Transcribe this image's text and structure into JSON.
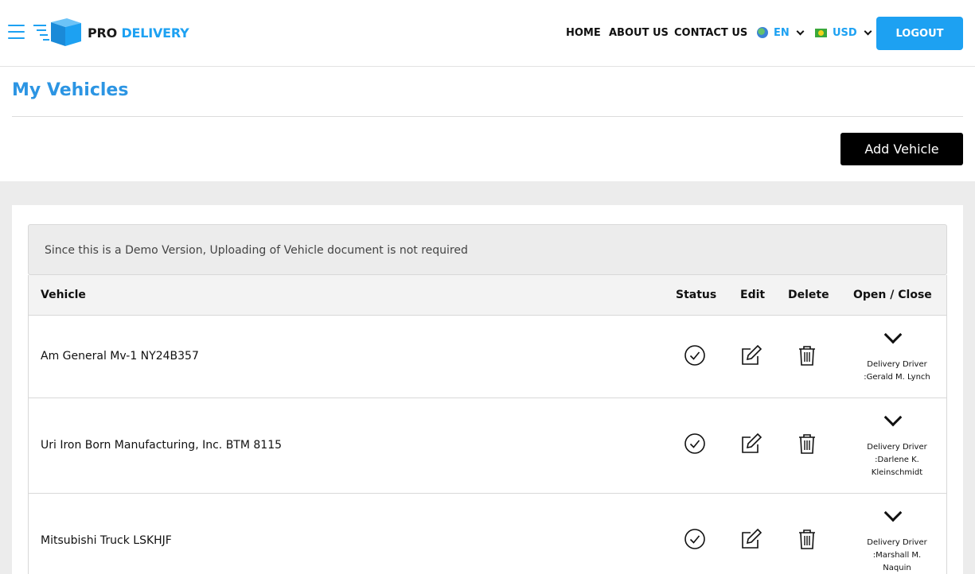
{
  "brand": {
    "pro": "PRO",
    "delivery": "DELIVERY",
    "accent": "#1da1f2"
  },
  "nav": {
    "home": "HOME",
    "about": "ABOUT US",
    "contact": "CONTACT US",
    "language": "EN",
    "currency": "USD",
    "logout": "LOGOUT"
  },
  "page": {
    "title": "My Vehicles",
    "add_button": "Add Vehicle",
    "notice": "Since this is a Demo Version, Uploading of Vehicle document is not required"
  },
  "table": {
    "headers": {
      "vehicle": "Vehicle",
      "status": "Status",
      "edit": "Edit",
      "delete": "Delete",
      "open_close": "Open / Close"
    },
    "rows": [
      {
        "vehicle": "Am General Mv-1 NY24B357",
        "driver_line1": "Delivery Driver",
        "driver_line2": ":Gerald M. Lynch",
        "driver_line3": ""
      },
      {
        "vehicle": "Uri Iron Born Manufacturing, Inc. BTM 8115",
        "driver_line1": "Delivery Driver",
        "driver_line2": ":Darlene K.",
        "driver_line3": "Kleinschmidt"
      },
      {
        "vehicle": "Mitsubishi Truck LSKHJF",
        "driver_line1": "Delivery Driver",
        "driver_line2": ":Marshall M.",
        "driver_line3": "Naquin"
      }
    ]
  },
  "icons": {
    "menu": "hamburger-icon",
    "status": "check-circle-icon",
    "edit": "edit-icon",
    "delete": "trash-icon",
    "toggle": "chevron-down-icon"
  }
}
